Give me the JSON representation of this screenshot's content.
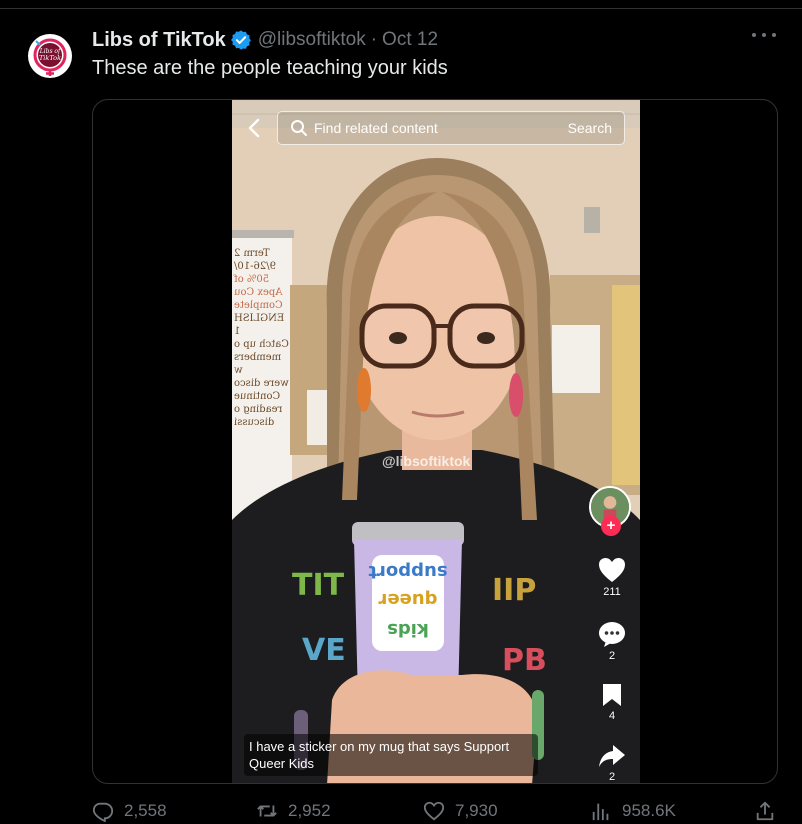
{
  "tweet": {
    "author_name": "Libs of TikTok",
    "handle": "@libsoftiktok",
    "separator": "·",
    "date": "Oct 12",
    "text": "These are the people teaching your kids",
    "avatar_text_line1": "Libs of",
    "avatar_text_line2": "TikTok"
  },
  "video": {
    "search_placeholder": "Find related content",
    "search_button": "Search",
    "watermark": "@libsoftiktok",
    "likes": "211",
    "comments": "2",
    "bookmarks": "4",
    "shares": "2",
    "caption": "I have a sticker on my mug that says Support Queer Kids",
    "mug_line1": "support",
    "mug_line2": "queer",
    "mug_line3": "kids",
    "board_lines": [
      "Term 2",
      "9/26-10/",
      "50% of",
      "Apex Cou",
      "Complete",
      "ENGLISH 1",
      "Catch up o",
      "members w",
      "were disco",
      "Continue",
      "reading o",
      "discussi"
    ]
  },
  "actions": {
    "replies": "2,558",
    "retweets": "2,952",
    "likes": "7,930",
    "views": "958.6K"
  },
  "colors": {
    "background": "#000000",
    "text_primary": "#e7e9ea",
    "text_secondary": "#71767b",
    "verified_blue": "#1d9bf0",
    "tiktok_red": "#fe2c55"
  }
}
